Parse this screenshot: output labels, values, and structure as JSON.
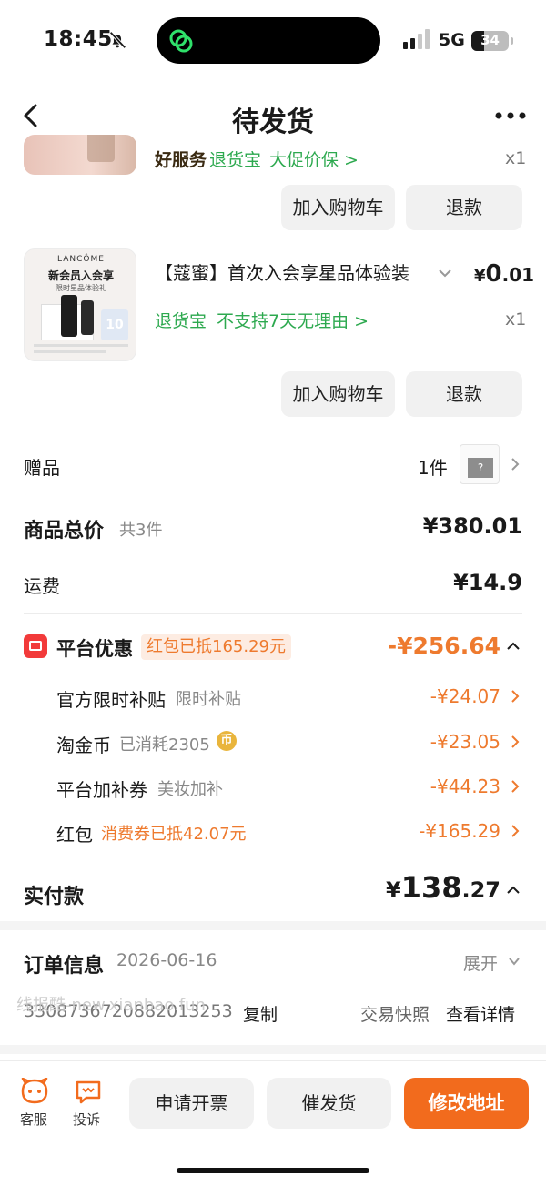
{
  "status_bar": {
    "time": "18:45",
    "network": "5G",
    "battery": "34"
  },
  "nav": {
    "title": "待发货"
  },
  "product1": {
    "tag_service": "好服务",
    "tag_return": "退货宝",
    "tag_promo": "大促价保 >",
    "qty": "x1",
    "btn_cart": "加入购物车",
    "btn_refund": "退款"
  },
  "product2": {
    "title": "【蔻蜜】首次入会享星品体验装",
    "price_symbol": "¥",
    "price_int": "0",
    "price_dec": ".01",
    "tag_return": "退货宝",
    "tag_policy": "不支持7天无理由 >",
    "qty": "x1",
    "btn_cart": "加入购物车",
    "btn_refund": "退款",
    "thumb_brand": "LANCÔME",
    "thumb_line1": "新会员入会享",
    "thumb_line2": "限时星品体验礼",
    "thumb_badge": "10"
  },
  "gift": {
    "label": "赠品",
    "count": "1件"
  },
  "summary": {
    "total_label": "商品总价",
    "total_count": "共3件",
    "total_value": "¥380.01",
    "shipping_label": "运费",
    "shipping_value": "¥14.9"
  },
  "platform_discount": {
    "label": "平台优惠",
    "chip": "红包已抵165.29元",
    "value": "-¥256.64",
    "items": [
      {
        "label": "官方限时补贴",
        "sub": "限时补贴",
        "value": "-¥24.07"
      },
      {
        "label": "淘金币",
        "sub": "已消耗2305",
        "value": "-¥23.05"
      },
      {
        "label": "平台加补券",
        "sub": "美妆加补",
        "value": "-¥44.23"
      },
      {
        "label": "红包",
        "sub": "消费券已抵42.07元",
        "value": "-¥165.29"
      }
    ]
  },
  "paid": {
    "label": "实付款",
    "symbol": "¥",
    "int": "138",
    "dec": ".27"
  },
  "order": {
    "label": "订单信息",
    "date": "2026-06-16",
    "expand": "展开",
    "number": "3308736720882013253",
    "copy": "复制",
    "snapshot": "交易快照",
    "details": "查看详情",
    "watermark": "线报酷-new.xianbao.fun"
  },
  "bottom": {
    "service": "客服",
    "complain": "投诉",
    "invoice": "申请开票",
    "urge": "催发货",
    "modify": "修改地址"
  },
  "colors": {
    "accent": "#f26b1d",
    "green": "#2da94f",
    "discount": "#ee7a2e"
  }
}
